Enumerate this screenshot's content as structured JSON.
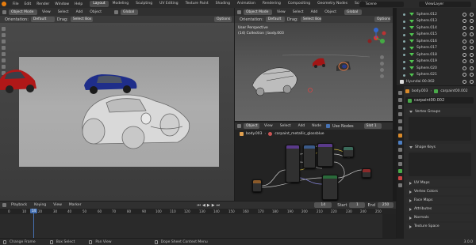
{
  "topbar": {
    "menus": [
      "File",
      "Edit",
      "Render",
      "Window",
      "Help"
    ],
    "workspaces": [
      "Layout",
      "Modeling",
      "Sculpting",
      "UV Editing",
      "Texture Paint",
      "Shading",
      "Animation",
      "Rendering",
      "Compositing",
      "Geometry Nodes",
      "Scripting"
    ],
    "active_workspace": "Layout",
    "scene": "Scene",
    "view_layer": "ViewLayer"
  },
  "left_view": {
    "mode": "Object Mode",
    "menus": [
      "View",
      "Select",
      "Add",
      "Object"
    ],
    "global": "Global",
    "orientation_label": "Orientation:",
    "orientation": "Default",
    "drag_label": "Drag:",
    "drag": "Select Box",
    "options": "Options"
  },
  "right_view": {
    "mode": "Object Mode",
    "menus": [
      "View",
      "Select",
      "Add",
      "Object"
    ],
    "global": "Global",
    "orientation_label": "Orientation:",
    "orientation": "Default",
    "drag_label": "Drag:",
    "drag": "Select Box",
    "options": "Options",
    "title": "User Perspective",
    "subtitle": "(14) Collection | body.003"
  },
  "node_editor": {
    "type": "Object",
    "menus": [
      "View",
      "Select",
      "Add",
      "Node"
    ],
    "use_nodes_label": "Use Nodes",
    "slot": "Slot 1",
    "object": "body.003",
    "material": "carpaint_metallic_glossblue"
  },
  "outliner": {
    "items": [
      "Sphere.012",
      "Sphere.013",
      "Sphere.014",
      "Sphere.015",
      "Sphere.016",
      "Sphere.017",
      "Sphere.018",
      "Sphere.019",
      "Sphere.020",
      "Sphere.021"
    ],
    "collection": "Hyundai 00.002"
  },
  "properties": {
    "object": "body.003",
    "material": "carpaint00.002",
    "data": "carpaint00.002",
    "panels_open": [
      "Vertex Groups",
      "Shape Keys"
    ],
    "panels_closed": [
      "UV Maps",
      "Vertex Colors",
      "Face Maps",
      "Attributes",
      "Normals",
      "Texture Space"
    ]
  },
  "timeline": {
    "menus": [
      "Playback",
      "Keying",
      "View",
      "Marker"
    ],
    "frames": [
      "0",
      "10",
      "20",
      "30",
      "40",
      "50",
      "60",
      "70",
      "80",
      "90",
      "100",
      "110",
      "120",
      "130",
      "140",
      "150",
      "160",
      "170",
      "180",
      "190",
      "200",
      "210",
      "220",
      "230",
      "240",
      "250"
    ],
    "current_frame": "14",
    "start_label": "Start",
    "start": "1",
    "end_label": "End",
    "end": "250"
  },
  "statusbar": {
    "items": [
      "Change Frame",
      "Box Select",
      "Pan View",
      "Dope Sheet Context Menu"
    ],
    "version": "3.0.0"
  }
}
